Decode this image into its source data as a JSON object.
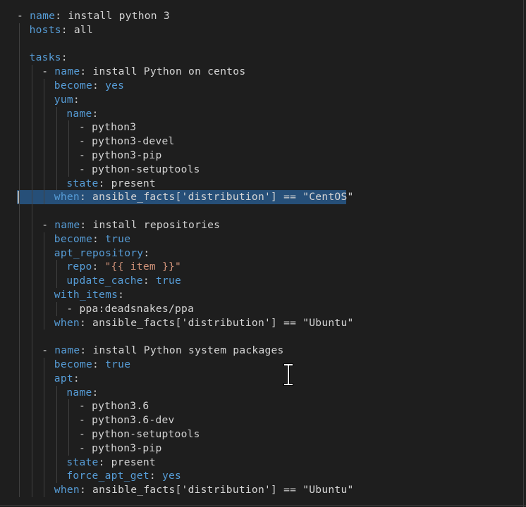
{
  "editor": {
    "language": "yaml",
    "lines": [
      {
        "indent": 0,
        "dash": "- ",
        "key": "name",
        "value": "install python 3",
        "value_type": "plain"
      },
      {
        "indent": 1,
        "dash": "",
        "key": "hosts",
        "value": "all",
        "value_type": "plain"
      },
      {
        "indent": 1,
        "blank": true
      },
      {
        "indent": 1,
        "dash": "",
        "key": "tasks",
        "value": "",
        "value_type": "plain"
      },
      {
        "indent": 2,
        "dash": "- ",
        "key": "name",
        "value": "install Python on centos",
        "value_type": "plain"
      },
      {
        "indent": 3,
        "dash": "",
        "key": "become",
        "value": "yes",
        "value_type": "bool"
      },
      {
        "indent": 3,
        "dash": "",
        "key": "yum",
        "value": "",
        "value_type": "plain"
      },
      {
        "indent": 4,
        "dash": "",
        "key": "name",
        "value": "",
        "value_type": "plain"
      },
      {
        "indent": 5,
        "dash": "- ",
        "key": "",
        "value": "python3",
        "value_type": "plain"
      },
      {
        "indent": 5,
        "dash": "- ",
        "key": "",
        "value": "python3-devel",
        "value_type": "plain"
      },
      {
        "indent": 5,
        "dash": "- ",
        "key": "",
        "value": "python3-pip",
        "value_type": "plain"
      },
      {
        "indent": 5,
        "dash": "- ",
        "key": "",
        "value": "python-setuptools",
        "value_type": "plain"
      },
      {
        "indent": 4,
        "dash": "",
        "key": "state",
        "value": "present",
        "value_type": "plain"
      },
      {
        "indent": 3,
        "dash": "",
        "key": "when",
        "value": "ansible_facts['distribution'] == \"CentOS\"",
        "value_type": "plain",
        "selected": true
      },
      {
        "indent": 2,
        "blank": true
      },
      {
        "indent": 2,
        "dash": "- ",
        "key": "name",
        "value": "install repositories",
        "value_type": "plain"
      },
      {
        "indent": 3,
        "dash": "",
        "key": "become",
        "value": "true",
        "value_type": "bool"
      },
      {
        "indent": 3,
        "dash": "",
        "key": "apt_repository",
        "value": "",
        "value_type": "plain"
      },
      {
        "indent": 4,
        "dash": "",
        "key": "repo",
        "value": "\"{{ item }}\"",
        "value_type": "string"
      },
      {
        "indent": 4,
        "dash": "",
        "key": "update_cache",
        "value": "true",
        "value_type": "bool"
      },
      {
        "indent": 3,
        "dash": "",
        "key": "with_items",
        "value": "",
        "value_type": "plain"
      },
      {
        "indent": 4,
        "dash": "- ",
        "key": "",
        "value": "ppa:deadsnakes/ppa",
        "value_type": "plain"
      },
      {
        "indent": 3,
        "dash": "",
        "key": "when",
        "value": "ansible_facts['distribution'] == \"Ubuntu\"",
        "value_type": "plain"
      },
      {
        "indent": 2,
        "blank": true
      },
      {
        "indent": 2,
        "dash": "- ",
        "key": "name",
        "value": "install Python system packages",
        "value_type": "plain"
      },
      {
        "indent": 3,
        "dash": "",
        "key": "become",
        "value": "true",
        "value_type": "bool"
      },
      {
        "indent": 3,
        "dash": "",
        "key": "apt",
        "value": "",
        "value_type": "plain"
      },
      {
        "indent": 4,
        "dash": "",
        "key": "name",
        "value": "",
        "value_type": "plain"
      },
      {
        "indent": 5,
        "dash": "- ",
        "key": "",
        "value": "python3.6",
        "value_type": "plain"
      },
      {
        "indent": 5,
        "dash": "- ",
        "key": "",
        "value": "python3.6-dev",
        "value_type": "plain"
      },
      {
        "indent": 5,
        "dash": "- ",
        "key": "",
        "value": "python-setuptools",
        "value_type": "plain"
      },
      {
        "indent": 5,
        "dash": "- ",
        "key": "",
        "value": "python3-pip",
        "value_type": "plain"
      },
      {
        "indent": 4,
        "dash": "",
        "key": "state",
        "value": "present",
        "value_type": "plain"
      },
      {
        "indent": 4,
        "dash": "",
        "key": "force_apt_get",
        "value": "yes",
        "value_type": "bool"
      },
      {
        "indent": 3,
        "dash": "",
        "key": "when",
        "value": "ansible_facts['distribution'] == \"Ubuntu\"",
        "value_type": "plain"
      }
    ]
  },
  "colors": {
    "background": "#1e1e1e",
    "key": "#569cd6",
    "text": "#d4d4d4",
    "selection": "#264f78",
    "indent_guide": "#404040"
  },
  "icons": {
    "mouse_cursor": "text-ibeam-cursor-icon"
  }
}
